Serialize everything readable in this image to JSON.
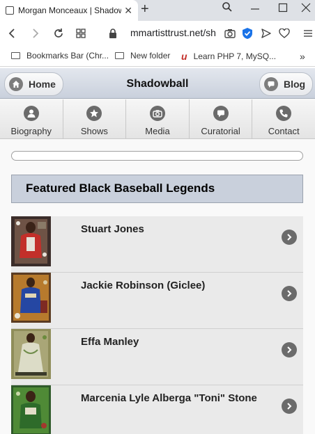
{
  "browser": {
    "tab_title": "Morgan Monceaux | Shadowball",
    "tab_close": "✕",
    "new_tab": "+",
    "url": "mmartisttrust.net/shadowball",
    "bookmarks": [
      "Bookmarks Bar (Chr...",
      "New folder",
      "Learn PHP 7, MySQ..."
    ],
    "overflow": "»"
  },
  "header": {
    "title": "Shadowball",
    "home_label": "Home",
    "blog_label": "Blog"
  },
  "nav": [
    {
      "label": "Biography",
      "icon": "person-icon"
    },
    {
      "label": "Shows",
      "icon": "star-icon"
    },
    {
      "label": "Media",
      "icon": "camera-icon"
    },
    {
      "label": "Curatorial",
      "icon": "comment-icon"
    },
    {
      "label": "Contact",
      "icon": "phone-icon"
    }
  ],
  "list": {
    "heading": "Featured Black Baseball Legends",
    "items": [
      {
        "title": "Stuart Jones"
      },
      {
        "title": "Jackie Robinson (Giclee)"
      },
      {
        "title": "Effa Manley"
      },
      {
        "title": "Marcenia Lyle Alberga \"Toni\" Stone"
      }
    ]
  }
}
